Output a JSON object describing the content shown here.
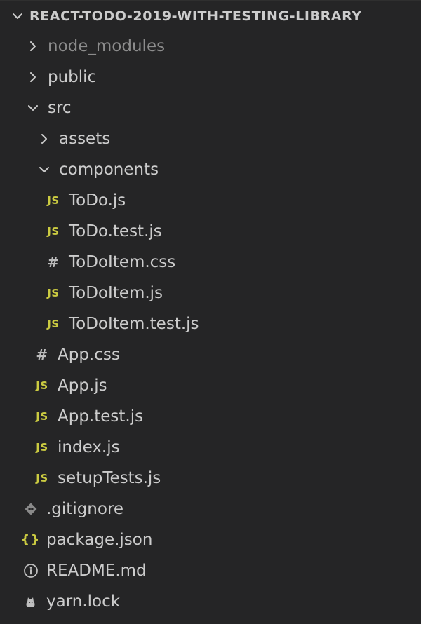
{
  "explorer": {
    "title": "REACT-TODO-2019-WITH-TESTING-LIBRARY",
    "items": [
      {
        "label": "node_modules",
        "kind": "folder",
        "expanded": false,
        "depth": 1,
        "dim": true,
        "icon": "chevron-right-icon"
      },
      {
        "label": "public",
        "kind": "folder",
        "expanded": false,
        "depth": 1,
        "icon": "chevron-right-icon"
      },
      {
        "label": "src",
        "kind": "folder",
        "expanded": true,
        "depth": 1,
        "icon": "chevron-down-icon"
      },
      {
        "label": "assets",
        "kind": "folder",
        "expanded": false,
        "depth": 2,
        "icon": "chevron-right-icon"
      },
      {
        "label": "components",
        "kind": "folder",
        "expanded": true,
        "depth": 2,
        "icon": "chevron-down-icon"
      },
      {
        "label": "ToDo.js",
        "kind": "file",
        "type": "js",
        "depth": 3,
        "icon": "js-file-icon",
        "icon_text": "JS"
      },
      {
        "label": "ToDo.test.js",
        "kind": "file",
        "type": "js",
        "depth": 3,
        "icon": "js-file-icon",
        "icon_text": "JS"
      },
      {
        "label": "ToDoItem.css",
        "kind": "file",
        "type": "css",
        "depth": 3,
        "icon": "css-file-icon",
        "icon_text": "#"
      },
      {
        "label": "ToDoItem.js",
        "kind": "file",
        "type": "js",
        "depth": 3,
        "icon": "js-file-icon",
        "icon_text": "JS"
      },
      {
        "label": "ToDoItem.test.js",
        "kind": "file",
        "type": "js",
        "depth": 3,
        "icon": "js-file-icon",
        "icon_text": "JS"
      },
      {
        "label": "App.css",
        "kind": "file",
        "type": "css",
        "depth": 2,
        "icon": "css-file-icon",
        "icon_text": "#"
      },
      {
        "label": "App.js",
        "kind": "file",
        "type": "js",
        "depth": 2,
        "icon": "js-file-icon",
        "icon_text": "JS"
      },
      {
        "label": "App.test.js",
        "kind": "file",
        "type": "js",
        "depth": 2,
        "icon": "js-file-icon",
        "icon_text": "JS"
      },
      {
        "label": "index.js",
        "kind": "file",
        "type": "js",
        "depth": 2,
        "icon": "js-file-icon",
        "icon_text": "JS"
      },
      {
        "label": "setupTests.js",
        "kind": "file",
        "type": "js",
        "depth": 2,
        "icon": "js-file-icon",
        "icon_text": "JS"
      },
      {
        "label": ".gitignore",
        "kind": "file",
        "type": "git",
        "depth": 1,
        "icon": "git-diamond-icon"
      },
      {
        "label": "package.json",
        "kind": "file",
        "type": "json",
        "depth": 1,
        "icon": "json-file-icon",
        "icon_text": "{}"
      },
      {
        "label": "README.md",
        "kind": "file",
        "type": "info",
        "depth": 1,
        "icon": "info-circle-icon"
      },
      {
        "label": "yarn.lock",
        "kind": "file",
        "type": "yarn",
        "depth": 1,
        "icon": "yarn-cat-icon"
      }
    ]
  },
  "colors": {
    "background": "#252526",
    "text": "#cccccc",
    "dim_text": "#8c8c8c",
    "js_yellow": "#cbcb41",
    "guide": "#585858"
  }
}
